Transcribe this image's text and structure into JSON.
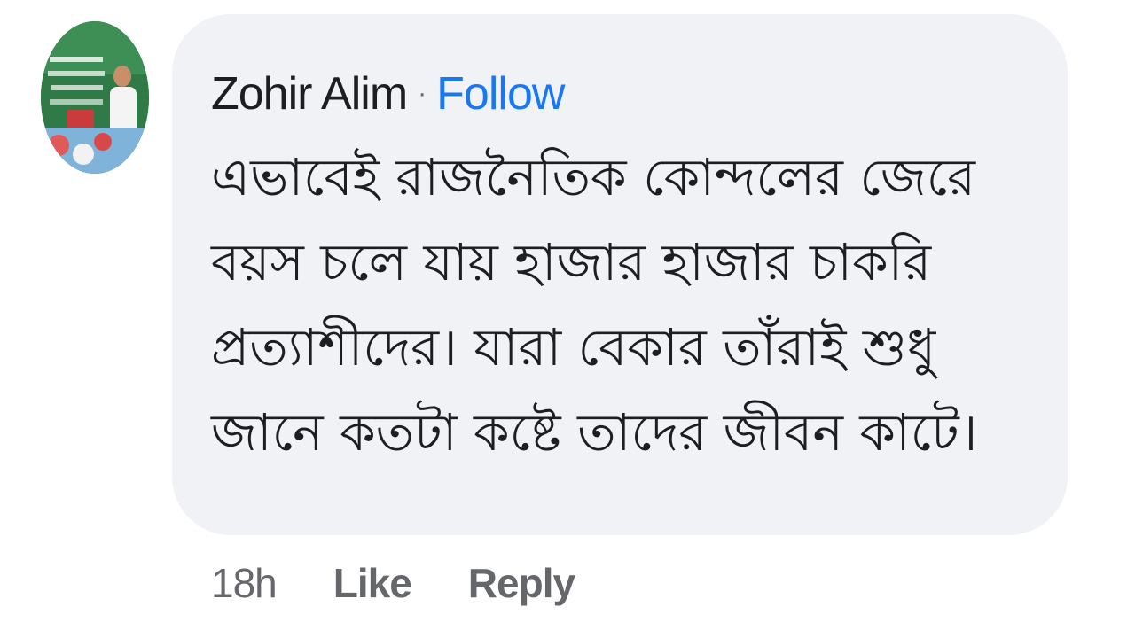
{
  "comment": {
    "author": "Zohir Alim",
    "separator": "·",
    "follow_label": "Follow",
    "text": "এভাবেই রাজনৈতিক কোন্দলের জেরে বয়স চলে যায় হাজার হাজার চাকরি প্রত্যাশীদের। যারা বেকার তাঁরাই শুধু জানে কতটা কষ্টে তাদের জীবন কাটে।",
    "avatar_icon": "profile-photo",
    "bubble_color": "#f0f2f5",
    "follow_color": "#1877f2"
  },
  "actions": {
    "timestamp": "18h",
    "like_label": "Like",
    "reply_label": "Reply"
  }
}
